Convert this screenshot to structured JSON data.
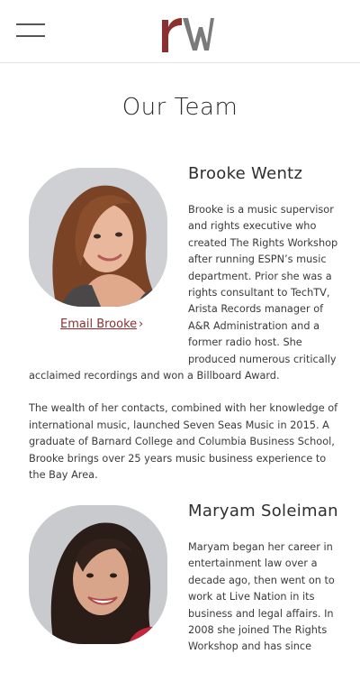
{
  "header": {
    "menu_icon": "hamburger-menu-icon",
    "logo_icon": "rw-logo",
    "logo_colors": {
      "r": "#8c2f2f",
      "w": "#7a7a7a"
    }
  },
  "page": {
    "title": "Our Team"
  },
  "team": [
    {
      "name": "Brooke Wentz",
      "email_label": "Email Brooke",
      "email_arrow": "›",
      "bio": [
        "Brooke is a music supervisor and rights executive who created The Rights Workshop after running ESPN’s music department. Prior she was a rights consultant to TechTV, Arista Records manager of A&R Administration and a former radio host. She produced numerous critically acclaimed recordings and won a Billboard Award.",
        "The wealth of her contacts, combined with her knowledge of international music, launched Seven Seas Music in 2015. A graduate of Barnard College and Columbia Business School, Brooke brings over 25 years music business experience to the Bay Area."
      ]
    },
    {
      "name": "Maryam Soleiman",
      "bio": [
        "Maryam began her career in entertainment law over a decade ago, then went on to work at Live Nation in its business and legal affairs. In 2008 she joined The Rights Workshop and has since"
      ]
    }
  ],
  "colors": {
    "accent": "#8c2f2f",
    "text": "#333333",
    "divider": "#e2e2e2"
  }
}
